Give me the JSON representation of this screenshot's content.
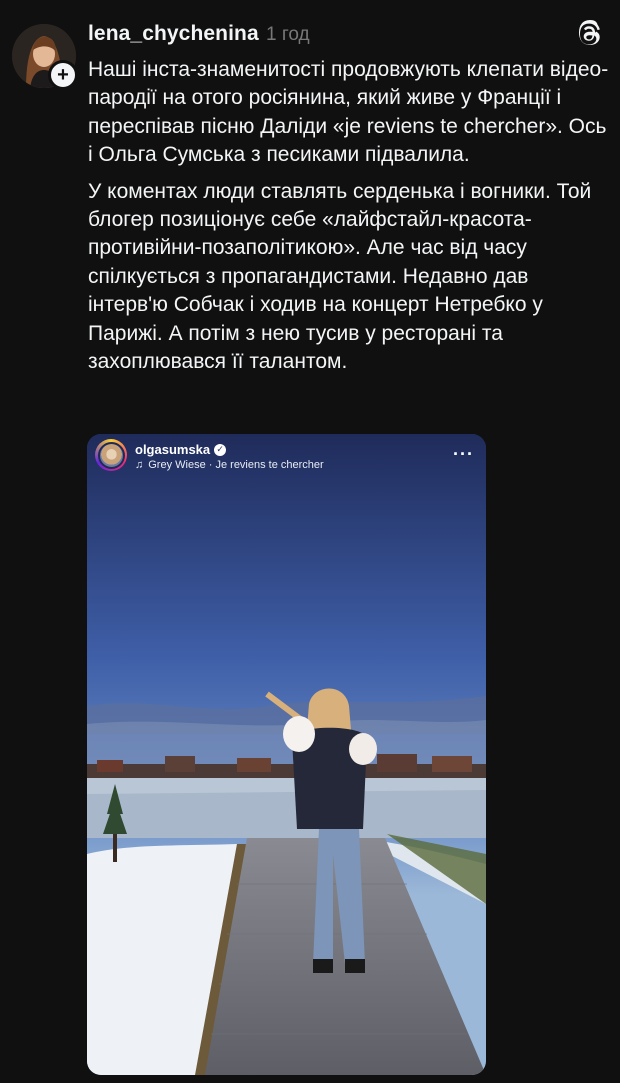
{
  "post": {
    "username": "lena_chychenina",
    "timestamp": "1 год",
    "paragraphs": [
      "Наші інста-знаменитості продовжують клепати відео-пародії на отого росіянина, який живе у Франції і переспівав пісню Даліди «je reviens te chercher». Ось і Ольга Сумська з песиками підвалила.",
      "У коментах люди ставлять серденька і вогники. Той блогер позиціонує себе «лайфстайл-красота-противійни-позаполітикою». Але час від часу спілкується з пропагандистами. Недавно дав інтерв'ю Собчак і ходив на концерт Нетребко у Парижі. А потім з нею тусив у ресторані та захоплювався її талантом."
    ],
    "icons": {
      "avatar": "user-avatar",
      "follow": "plus-icon",
      "app": "threads-logo-icon"
    }
  },
  "embed": {
    "username": "olgasumska",
    "audio": "Grey Wiese · Je reviens te chercher",
    "icons": {
      "verified": "verified-badge-icon",
      "music": "music-note-icon",
      "more": "more-dots-icon"
    }
  },
  "colors": {
    "background": "#101010",
    "text": "#f3f5f7",
    "muted": "#777777"
  }
}
